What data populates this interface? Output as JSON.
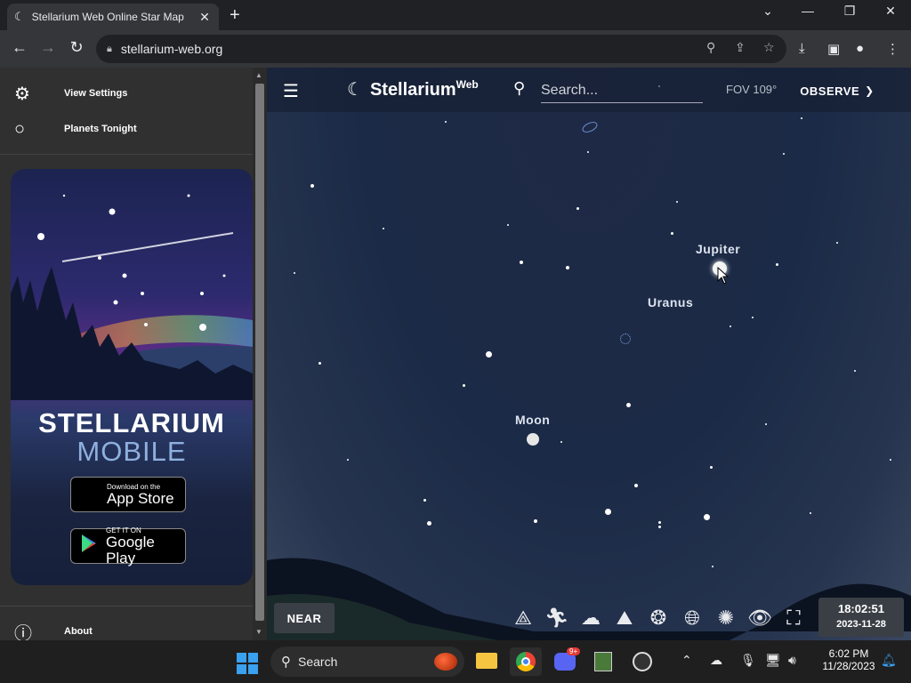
{
  "browser": {
    "tab_title": "Stellarium Web Online Star Map",
    "tab_close": "✕",
    "new_tab": "+",
    "url": "stellarium-web.org",
    "win_min": "—",
    "win_restore": "❐",
    "win_close": "✕",
    "win_chevron": "⌄"
  },
  "sidebar": {
    "items": [
      {
        "label": "View Settings",
        "icon": "gear-icon"
      },
      {
        "label": "Planets Tonight",
        "icon": "circle-icon"
      }
    ],
    "promo": {
      "title": "STELLARIUM",
      "subtitle": "MOBILE",
      "app_store_small": "Download on the",
      "app_store_big": "App Store",
      "google_small": "GET IT ON",
      "google_big": "Google Play"
    },
    "about_label": "About"
  },
  "sky": {
    "brand": "Stellarium",
    "brand_sup": "Web",
    "search_placeholder": "Search...",
    "fov": "FOV 109°",
    "observe": "OBSERVE",
    "labels": [
      {
        "text": "Jupiter"
      },
      {
        "text": "Uranus"
      },
      {
        "text": "Moon"
      }
    ],
    "near_button": "NEAR",
    "time": "18:02:51",
    "date": "2023-11-28",
    "accent": "#ffffff"
  },
  "taskbar": {
    "search_label": "Search",
    "clock_time": "6:02 PM",
    "clock_date": "11/28/2023",
    "discord_badge": "9+"
  }
}
